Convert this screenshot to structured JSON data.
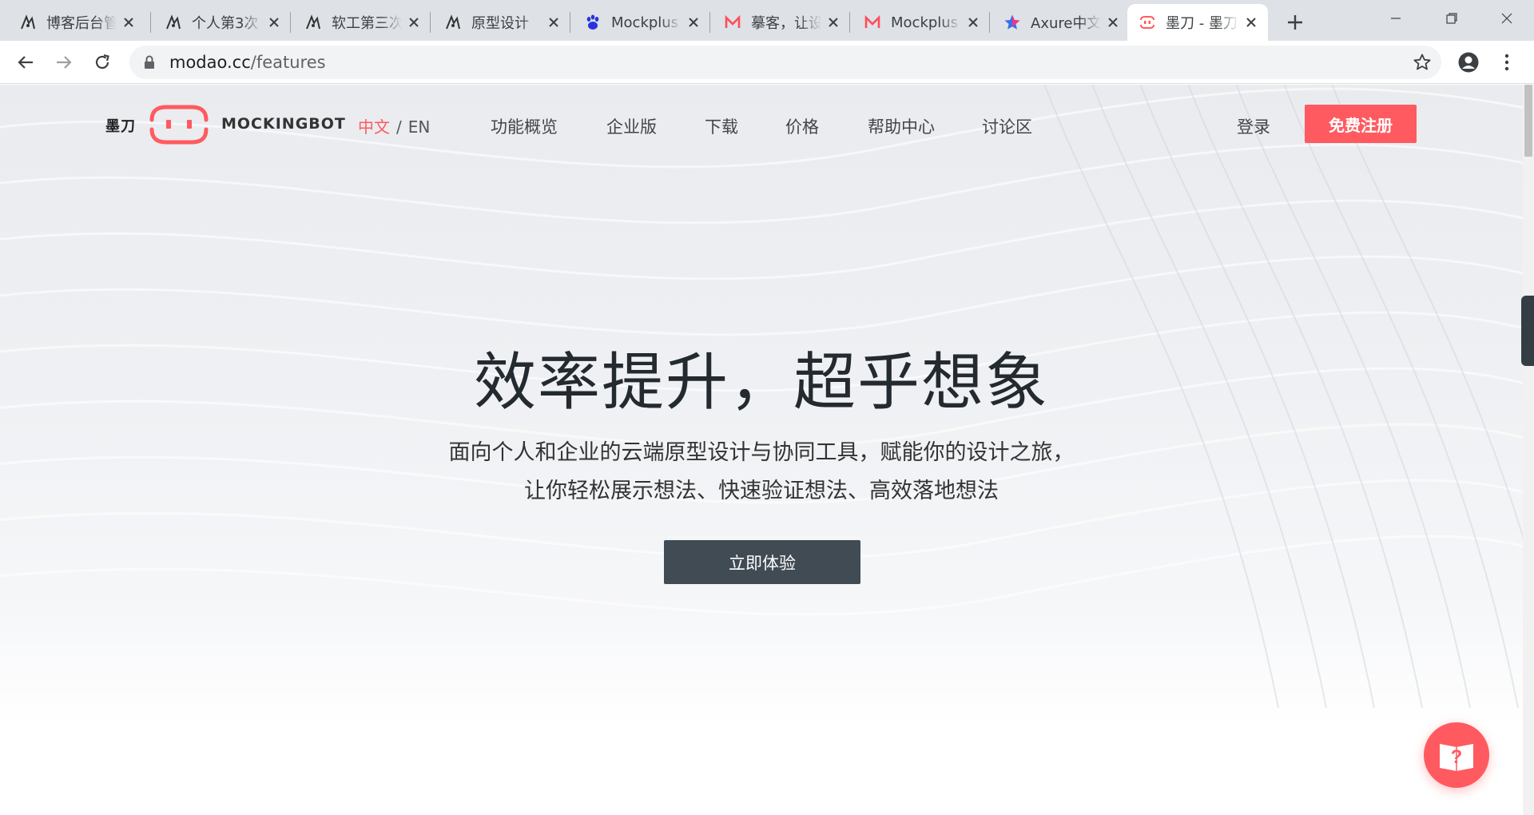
{
  "browser": {
    "tabs": [
      {
        "title": "博客后台管",
        "icon": "cnblogs-icon",
        "active": false
      },
      {
        "title": "个人第3次",
        "icon": "cnblogs-icon",
        "active": false
      },
      {
        "title": "软工第三次",
        "icon": "cnblogs-icon",
        "active": false
      },
      {
        "title": "原型设计",
        "icon": "cnblogs-icon",
        "active": false
      },
      {
        "title": "Mockplus",
        "icon": "baidu-paw-icon",
        "active": false
      },
      {
        "title": "摹客，让设",
        "icon": "mockplus-m-icon",
        "active": false
      },
      {
        "title": "Mockplus",
        "icon": "mockplus-m-icon",
        "active": false
      },
      {
        "title": "Axure中文",
        "icon": "axure-star-icon",
        "active": false
      },
      {
        "title": "墨刀 - 墨刀",
        "icon": "modao-icon",
        "active": true
      }
    ],
    "address": {
      "host": "modao.cc",
      "path": "/features"
    }
  },
  "site": {
    "logo_cn": "墨刀",
    "logo_en": "MOCKINGBOT",
    "lang_cn": "中文",
    "lang_sep": "/",
    "lang_en": "EN",
    "nav": [
      "功能概览",
      "企业版",
      "下载",
      "价格",
      "帮助中心",
      "讨论区"
    ],
    "login": "登录",
    "signup": "免费注册"
  },
  "hero": {
    "title": "效率提升，超乎想象",
    "subtitle_line1": "面向个人和企业的云端原型设计与协同工具，赋能你的设计之旅，",
    "subtitle_line2": "让你轻松展示想法、快速验证想法、高效落地想法",
    "cta": "立即体验"
  },
  "help": {
    "glyph": "?"
  },
  "colors": {
    "brand": "#ff5a5f",
    "cta": "#414b54",
    "title": "#232a30"
  }
}
